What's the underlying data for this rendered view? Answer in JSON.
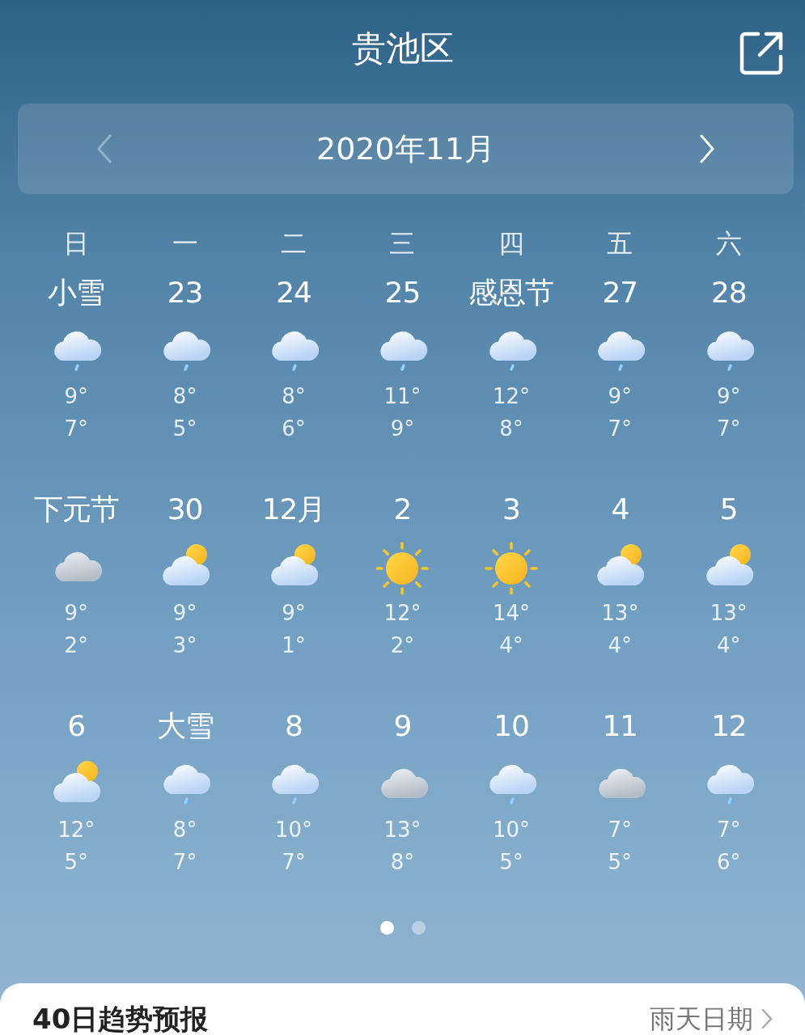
{
  "header": {
    "title": "贵池区"
  },
  "month_bar": {
    "title": "2020年11月",
    "prev_arrow": {
      "disabled": true
    },
    "next_arrow": {
      "disabled": false
    }
  },
  "weekdays": [
    "日",
    "一",
    "二",
    "三",
    "四",
    "五",
    "六"
  ],
  "days": [
    {
      "label": "小雪",
      "kind": "rain",
      "high": "9°",
      "low": "7°"
    },
    {
      "label": "23",
      "kind": "rain",
      "high": "8°",
      "low": "5°"
    },
    {
      "label": "24",
      "kind": "rain",
      "high": "8°",
      "low": "6°"
    },
    {
      "label": "25",
      "kind": "rain",
      "high": "11°",
      "low": "9°"
    },
    {
      "label": "感恩节",
      "kind": "rain",
      "high": "12°",
      "low": "8°"
    },
    {
      "label": "27",
      "kind": "rain",
      "high": "9°",
      "low": "7°"
    },
    {
      "label": "28",
      "kind": "rain",
      "high": "9°",
      "low": "7°"
    },
    {
      "label": "下元节",
      "kind": "overcast",
      "high": "9°",
      "low": "2°"
    },
    {
      "label": "30",
      "kind": "partly",
      "high": "9°",
      "low": "3°"
    },
    {
      "label": "12月",
      "kind": "partly",
      "high": "9°",
      "low": "1°"
    },
    {
      "label": "2",
      "kind": "sunny",
      "high": "12°",
      "low": "2°"
    },
    {
      "label": "3",
      "kind": "sunny",
      "high": "14°",
      "low": "4°"
    },
    {
      "label": "4",
      "kind": "partly",
      "high": "13°",
      "low": "4°"
    },
    {
      "label": "5",
      "kind": "partly",
      "high": "13°",
      "low": "4°"
    },
    {
      "label": "6",
      "kind": "partly",
      "high": "12°",
      "low": "5°"
    },
    {
      "label": "大雪",
      "kind": "rain",
      "high": "8°",
      "low": "7°"
    },
    {
      "label": "8",
      "kind": "rain",
      "high": "10°",
      "low": "7°"
    },
    {
      "label": "9",
      "kind": "overcast",
      "high": "13°",
      "low": "8°"
    },
    {
      "label": "10",
      "kind": "rain",
      "high": "10°",
      "low": "5°"
    },
    {
      "label": "11",
      "kind": "overcast",
      "high": "7°",
      "low": "5°"
    },
    {
      "label": "12",
      "kind": "rain",
      "high": "7°",
      "low": "6°"
    }
  ],
  "pages": [
    {
      "selected": true
    },
    {
      "selected": false
    }
  ],
  "trend_card": {
    "title": "40日趋势预报",
    "link": "雨天日期"
  }
}
